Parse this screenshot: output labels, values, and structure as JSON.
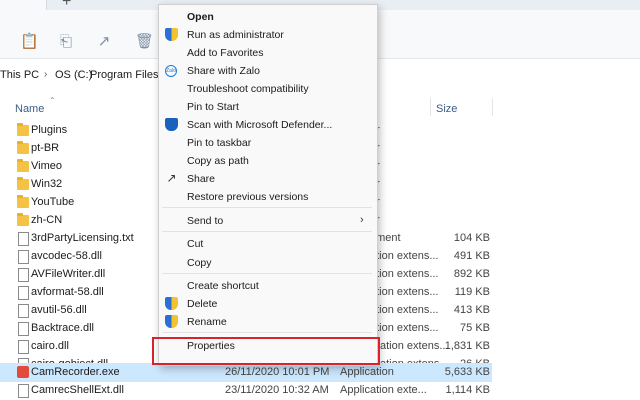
{
  "tabs": {
    "new_tab": "+"
  },
  "breadcrumb": [
    "This PC",
    "OS (C:)",
    "Program Files"
  ],
  "columns": {
    "name": "Name",
    "size": "Size"
  },
  "files": [
    {
      "name": "Plugins",
      "type": "",
      "date": "",
      "size": "",
      "kind": "folder"
    },
    {
      "name": "pt-BR",
      "type": "",
      "date": "",
      "size": "",
      "kind": "folder"
    },
    {
      "name": "Vimeo",
      "type": "",
      "date": "",
      "size": "",
      "kind": "folder"
    },
    {
      "name": "Win32",
      "type": "",
      "date": "",
      "size": "",
      "kind": "folder"
    },
    {
      "name": "YouTube",
      "type": "",
      "date": "",
      "size": "",
      "kind": "folder"
    },
    {
      "name": "zh-CN",
      "type": "",
      "date": "",
      "size": "",
      "kind": "folder"
    },
    {
      "name": "3rdPartyLicensing.txt",
      "type": "ument",
      "date": "",
      "size": "104 KB",
      "kind": "doc"
    },
    {
      "name": "avcodec-58.dll",
      "type": "ation extens...",
      "date": "",
      "size": "491 KB",
      "kind": "doc"
    },
    {
      "name": "AVFileWriter.dll",
      "type": "ation extens...",
      "date": "",
      "size": "892 KB",
      "kind": "doc"
    },
    {
      "name": "avformat-58.dll",
      "type": "ation extens...",
      "date": "",
      "size": "119 KB",
      "kind": "doc"
    },
    {
      "name": "avutil-56.dll",
      "type": "ation extens...",
      "date": "",
      "size": "413 KB",
      "kind": "doc"
    },
    {
      "name": "Backtrace.dll",
      "type": "ation extens...",
      "date": "",
      "size": "75 KB",
      "kind": "doc"
    },
    {
      "name": "cairo.dll",
      "type": "ation extens...",
      "date": "",
      "size": "1,831 KB",
      "kind": "doc"
    },
    {
      "name": "cairo-gobject.dll",
      "type": "ation extens...",
      "date": "",
      "size": "26 KB",
      "kind": "doc"
    },
    {
      "name": "CamRecorder.exe",
      "type": "Application",
      "date": "26/11/2020 10:01 PM",
      "size": "5,633 KB",
      "kind": "exe"
    },
    {
      "name": "CamrecShellExt.dll",
      "type": "Application exte...",
      "date": "23/11/2020 10:32 AM",
      "size": "1,114 KB",
      "kind": "doc"
    }
  ],
  "folder_type_fragment": "er",
  "context_menu": {
    "open": "Open",
    "run_as_admin": "Run as administrator",
    "add_favorites": "Add to Favorites",
    "share_zalo": "Share with Zalo",
    "troubleshoot": "Troubleshoot compatibility",
    "pin_start": "Pin to Start",
    "scan_defender": "Scan with Microsoft Defender...",
    "pin_taskbar": "Pin to taskbar",
    "copy_path": "Copy as path",
    "share": "Share",
    "restore": "Restore previous versions",
    "send_to": "Send to",
    "cut": "Cut",
    "copy": "Copy",
    "create_shortcut": "Create shortcut",
    "delete": "Delete",
    "rename": "Rename",
    "properties": "Properties"
  },
  "colors": {
    "highlight_box": "#d9222a",
    "selected_row": "#cce8ff",
    "folder": "#f4c244"
  }
}
